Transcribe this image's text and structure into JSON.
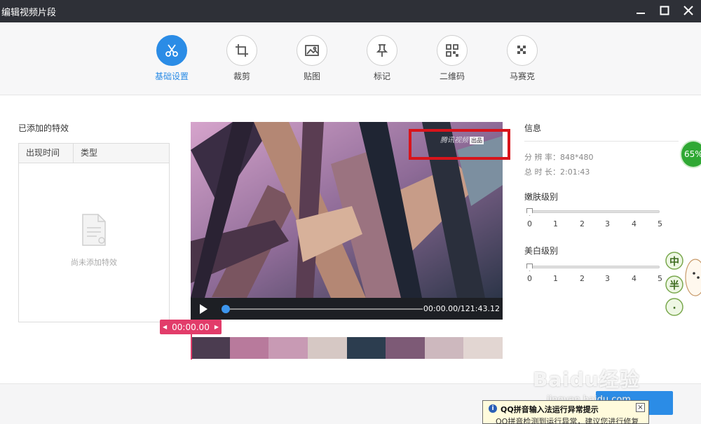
{
  "window": {
    "title": "编辑视频片段",
    "minimize": "minimize",
    "maximize": "maximize",
    "close": "close"
  },
  "toolbar": {
    "items": [
      {
        "label": "基础设置",
        "icon": "scissors-icon",
        "active": true
      },
      {
        "label": "裁剪",
        "icon": "crop-icon",
        "active": false
      },
      {
        "label": "贴图",
        "icon": "image-icon",
        "active": false
      },
      {
        "label": "标记",
        "icon": "pin-icon",
        "active": false
      },
      {
        "label": "二维码",
        "icon": "qrcode-icon",
        "active": false
      },
      {
        "label": "马赛克",
        "icon": "mosaic-icon",
        "active": false
      }
    ]
  },
  "effects": {
    "title": "已添加的特效",
    "columns": [
      "出现时间",
      "类型"
    ],
    "empty_text": "尚未添加特效"
  },
  "player": {
    "watermark": "腾讯视频",
    "watermark_badge": "出品",
    "timecode": "00:00.00/121:43.12",
    "cursor_time": "00:00.00",
    "progress": 0
  },
  "info": {
    "title": "信息",
    "resolution_label": "分 辨 率：",
    "resolution_value": "848*480",
    "duration_label": "总 时 长：",
    "duration_value": "2:01:43",
    "skin_label": "嫩肤级别",
    "whiten_label": "美白级别",
    "scale": [
      "0",
      "1",
      "2",
      "3",
      "4",
      "5"
    ],
    "skin_level": 0,
    "whiten_level": 0
  },
  "overlay": {
    "percent": "65%",
    "mascot_chars": [
      "中",
      "半",
      "·"
    ]
  },
  "footer": {
    "ok_label": "com",
    "baidu_text": "Baidu经验",
    "baidu_url": "jingyan.baidu.com"
  },
  "popup": {
    "title": "QQ拼音输入法运行异常提示",
    "body": "QQ拼音检测到运行异常，建议您进行修复",
    "close": "×"
  }
}
